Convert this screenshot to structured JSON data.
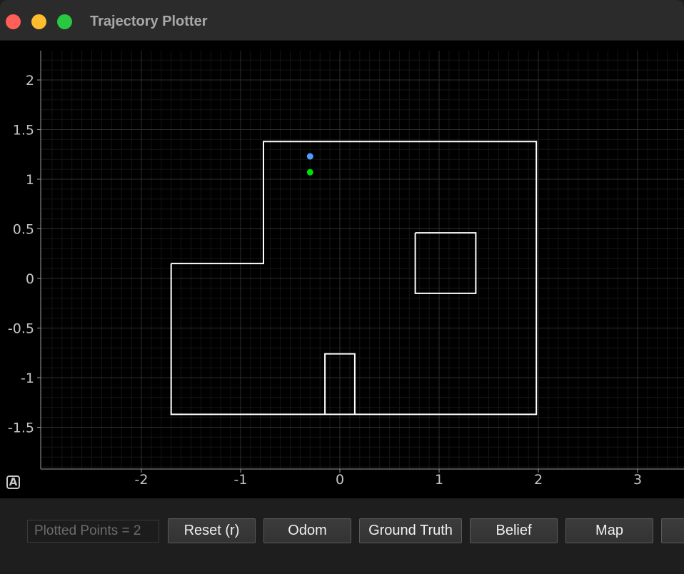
{
  "window": {
    "title": "Trajectory Plotter"
  },
  "plot": {
    "x_ticks": [
      "-2",
      "-1",
      "0",
      "1",
      "2",
      "3"
    ],
    "y_ticks": [
      "2",
      "1.5",
      "1",
      "0.5",
      "0",
      "-0.5",
      "-1",
      "-1.5"
    ],
    "auto_range_label": "A",
    "colors": {
      "background": "#000000",
      "walls": "#ffffff",
      "odom_point": "#4a9eff",
      "ground_truth_point": "#00dd00"
    }
  },
  "chart_data": {
    "type": "scatter",
    "xlim": [
      -3,
      3.5
    ],
    "ylim": [
      -1.9,
      2.3
    ],
    "grid": true,
    "map_walls": [
      [
        [
          -1.7,
          0.15
        ],
        [
          -0.77,
          0.15
        ],
        [
          -0.77,
          1.38
        ],
        [
          1.98,
          1.38
        ],
        [
          1.98,
          -1.37
        ],
        [
          -1.7,
          -1.37
        ],
        [
          -1.7,
          0.15
        ]
      ],
      [
        [
          0.76,
          0.46
        ],
        [
          1.37,
          0.46
        ],
        [
          1.37,
          -0.15
        ],
        [
          0.76,
          -0.15
        ],
        [
          0.76,
          0.46
        ]
      ],
      [
        [
          -0.15,
          -1.37
        ],
        [
          -0.15,
          -0.76
        ],
        [
          0.15,
          -0.76
        ],
        [
          0.15,
          -1.37
        ]
      ]
    ],
    "series": [
      {
        "color": "#4a9eff",
        "points": [
          {
            "x": -0.3,
            "y": 1.23
          }
        ]
      },
      {
        "color": "#00dd00",
        "points": [
          {
            "x": -0.3,
            "y": 1.07
          }
        ]
      }
    ]
  },
  "toolbar": {
    "counter_text": "Plotted Points = 2",
    "buttons": [
      "Reset (r)",
      "Odom",
      "Ground Truth",
      "Belief",
      "Map",
      ""
    ]
  }
}
